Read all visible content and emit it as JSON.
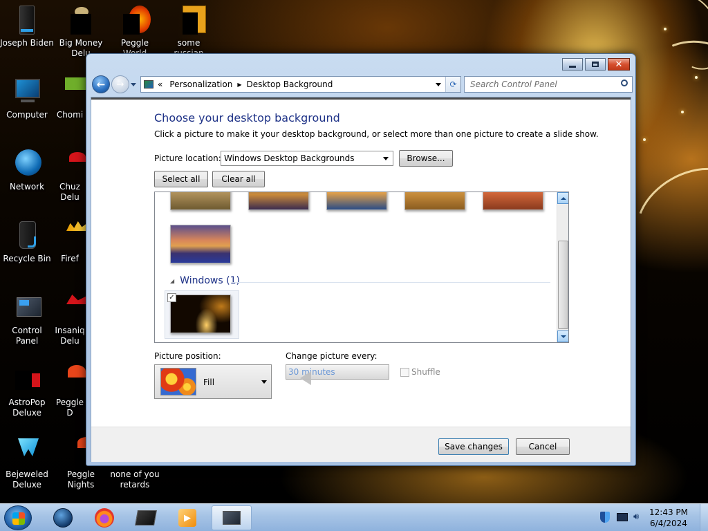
{
  "desktop": {
    "icons": [
      {
        "label": "Joseph Biden",
        "icon": "computer-tower-icon"
      },
      {
        "label": "Big Money Delu",
        "icon": "big-money-icon"
      },
      {
        "label": "Peggle World",
        "icon": "peggle-icon"
      },
      {
        "label": "some russian",
        "icon": "java-file-icon"
      },
      {
        "label": "Computer",
        "icon": "monitor-icon"
      },
      {
        "label": "Chomi",
        "icon": "chomi-icon"
      },
      {
        "label": "Network",
        "icon": "network-globe-icon"
      },
      {
        "label": "Chuz Delu",
        "icon": "chuzzle-icon"
      },
      {
        "label": "Recycle Bin",
        "icon": "recycle-bin-icon"
      },
      {
        "label": "Firef",
        "icon": "firefly-icon"
      },
      {
        "label": "Control Panel",
        "icon": "control-panel-icon"
      },
      {
        "label": "Insaniq Delu",
        "icon": "insaniquarium-icon"
      },
      {
        "label": "AstroPop Deluxe",
        "icon": "astropop-icon"
      },
      {
        "label": "Peggle D",
        "icon": "peggle-icon"
      },
      {
        "label": "Bejeweled Deluxe",
        "icon": "bejeweled-icon"
      },
      {
        "label": "Peggle Nights Deluxe",
        "icon": "peggle-icon"
      },
      {
        "label": "none of you retards kno...",
        "icon": "blank-file-icon"
      }
    ]
  },
  "window": {
    "breadcrumb": {
      "overflow": "«",
      "items": [
        "Personalization",
        "Desktop Background"
      ]
    },
    "search_placeholder": "Search Control Panel",
    "heading": "Choose your desktop background",
    "description": "Click a picture to make it your desktop background, or select more than one picture to create a slide show.",
    "picture_location_label": "Picture location:",
    "picture_location_value": "Windows Desktop Backgrounds",
    "browse_label": "Browse...",
    "select_all_label": "Select all",
    "clear_all_label": "Clear all",
    "group_windows": "Windows (1)",
    "picture_position_label": "Picture position:",
    "picture_position_value": "Fill",
    "change_every_label": "Change picture every:",
    "change_every_value": "30 minutes",
    "shuffle_label": "Shuffle",
    "save_label": "Save changes",
    "cancel_label": "Cancel",
    "windows_thumb_checked": true
  },
  "taskbar": {
    "time": "12:43 PM",
    "date": "6/4/2024"
  },
  "colors": {
    "heading": "#1e3287",
    "accent": "#3a7bd5",
    "taskbar": "#a5c3e5"
  }
}
